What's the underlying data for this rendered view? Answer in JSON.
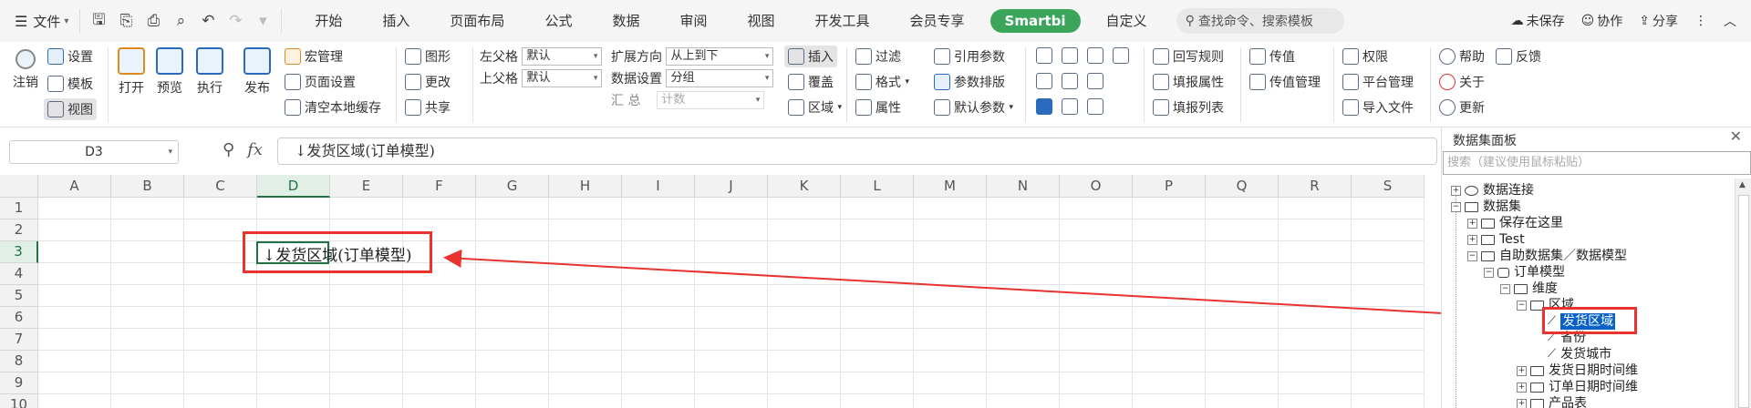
{
  "menu": {
    "file": "文件",
    "tabs": [
      "开始",
      "插入",
      "页面布局",
      "公式",
      "数据",
      "审阅",
      "视图",
      "开发工具",
      "会员专享",
      "Smartbi",
      "自定义"
    ],
    "search": "查找命令、搜索模板",
    "unsaved": "未保存",
    "collab": "协作",
    "share": "分享"
  },
  "ribbon": {
    "register": "注销",
    "settings": "设置",
    "template": "模板",
    "view": "视图",
    "open": "打开",
    "preview": "预览",
    "execute": "执行",
    "publish": "发布",
    "macro": "宏管理",
    "page_setup": "页面设置",
    "clear_cache": "清空本地缓存",
    "shape": "图形",
    "change": "更改",
    "share": "共享",
    "left_parent": "左父格",
    "left_parent_val": "默认",
    "top_parent": "上父格",
    "top_parent_val": "默认",
    "summary": "汇  总",
    "expand_dir": "扩展方向",
    "expand_val": "从上到下",
    "data_setting": "数据设置",
    "data_val": "分组",
    "summary_val": "计数",
    "insert": "插入",
    "cover": "覆盖",
    "area": "区域",
    "filter": "过滤",
    "format": "格式",
    "property": "属性",
    "ref_param": "引用参数",
    "param_layout": "参数排版",
    "default_param": "默认参数",
    "writeback": "回写规则",
    "fill_attr": "填报属性",
    "fill_list": "填报列表",
    "pass_val": "传值",
    "pass_mgmt": "传值管理",
    "permission": "权限",
    "platform": "平台管理",
    "import_file": "导入文件",
    "help": "帮助",
    "feedback": "反馈",
    "about": "关于",
    "update": "更新"
  },
  "formula": {
    "cell_ref": "D3",
    "content": "↓发货区域(订单模型)"
  },
  "grid": {
    "columns": [
      "A",
      "B",
      "C",
      "D",
      "E",
      "F",
      "G",
      "H",
      "I",
      "J",
      "K",
      "L",
      "M",
      "N",
      "O",
      "P",
      "Q",
      "R",
      "S"
    ],
    "rows": [
      "1",
      "2",
      "3",
      "4",
      "5",
      "6",
      "7",
      "8",
      "9",
      "10"
    ],
    "cell_d3": "↓发货区域(订单模型)",
    "selected_col": "D",
    "selected_row": "3"
  },
  "panel": {
    "title": "数据集面板",
    "search_placeholder": "搜索（建议使用鼠标粘贴）",
    "tree": [
      "数据连接",
      "数据集",
      "保存在这里",
      "Test",
      "自助数据集／数据模型",
      "订单模型",
      "维度",
      "区域",
      "发货区域",
      "省份",
      "发货城市",
      "发货日期时间维",
      "订单日期时间维",
      "产品表"
    ]
  }
}
